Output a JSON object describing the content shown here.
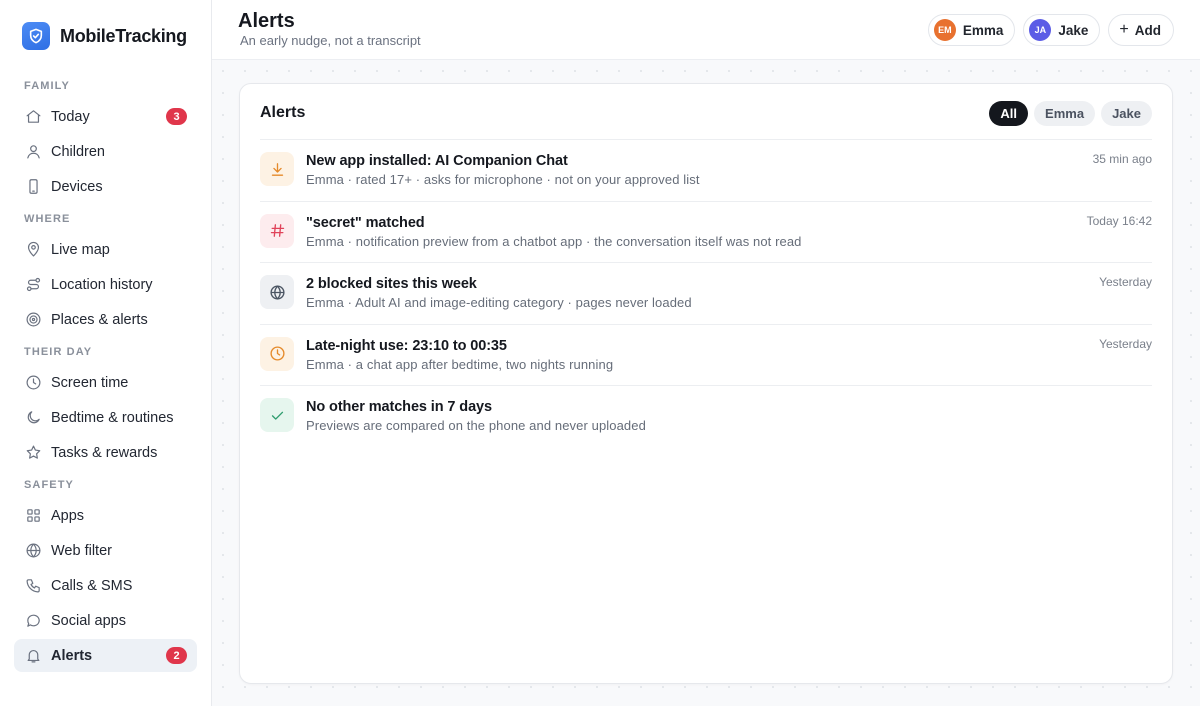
{
  "brand": {
    "name": "MobileTracking"
  },
  "sidebar": {
    "sections": [
      {
        "title": "FAMILY",
        "items": [
          {
            "label": "Today",
            "icon": "home-icon",
            "badge": "3"
          },
          {
            "label": "Children",
            "icon": "user-icon"
          },
          {
            "label": "Devices",
            "icon": "phone-icon"
          }
        ]
      },
      {
        "title": "WHERE",
        "items": [
          {
            "label": "Live map",
            "icon": "map-pin-icon"
          },
          {
            "label": "Location history",
            "icon": "route-icon"
          },
          {
            "label": "Places & alerts",
            "icon": "target-icon"
          }
        ]
      },
      {
        "title": "THEIR DAY",
        "items": [
          {
            "label": "Screen time",
            "icon": "clock-icon"
          },
          {
            "label": "Bedtime & routines",
            "icon": "moon-icon"
          },
          {
            "label": "Tasks & rewards",
            "icon": "star-icon"
          }
        ]
      },
      {
        "title": "SAFETY",
        "items": [
          {
            "label": "Apps",
            "icon": "grid-icon"
          },
          {
            "label": "Web filter",
            "icon": "globe-icon"
          },
          {
            "label": "Calls & SMS",
            "icon": "phone-call-icon"
          },
          {
            "label": "Social apps",
            "icon": "chat-bubble-icon"
          },
          {
            "label": "Alerts",
            "icon": "bell-icon",
            "badge": "2",
            "active": true
          }
        ]
      }
    ]
  },
  "header": {
    "title": "Alerts",
    "subtitle": "An early nudge, not a transcript",
    "children": [
      {
        "initials": "EM",
        "name": "Emma",
        "color": "#e8712f"
      },
      {
        "initials": "JA",
        "name": "Jake",
        "color": "#5b5ce6"
      }
    ],
    "add_label": "Add"
  },
  "card": {
    "title": "Alerts",
    "filters": [
      "All",
      "Emma",
      "Jake"
    ],
    "active_filter": "All",
    "alerts": [
      {
        "icon": "download-icon",
        "icon_color": "#e58a2a",
        "icon_bg": "#fdf2e4",
        "title": "New app installed: AI Companion Chat",
        "detail": "Emma · rated 17+ · asks for microphone · not on your approved list",
        "time": "35 min ago"
      },
      {
        "icon": "hashtag-icon",
        "icon_color": "#e0435a",
        "icon_bg": "#fdecee",
        "title": "\"secret\" matched",
        "detail": "Emma · notification preview from a chatbot app · the conversation itself was not read",
        "time": "Today 16:42"
      },
      {
        "icon": "globe-icon",
        "icon_color": "#4b5563",
        "icon_bg": "#eef0f3",
        "title": "2 blocked sites this week",
        "detail": "Emma · Adult AI and image-editing category · pages never loaded",
        "time": "Yesterday"
      },
      {
        "icon": "clock-icon",
        "icon_color": "#e58a2a",
        "icon_bg": "#fdf2e4",
        "title": "Late-night use: 23:10 to 00:35",
        "detail": "Emma · a chat app after bedtime, two nights running",
        "time": "Yesterday"
      },
      {
        "icon": "check-icon",
        "icon_color": "#2f9d6e",
        "icon_bg": "#e6f6ee",
        "title": "No other matches in 7 days",
        "detail": "Previews are compared on the phone and never uploaded",
        "time": ""
      }
    ]
  }
}
